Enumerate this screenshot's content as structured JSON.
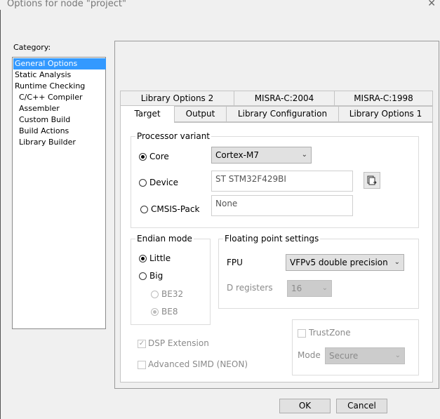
{
  "window": {
    "title": "Options for node \"project\"",
    "close_glyph": "✕"
  },
  "category": {
    "label": "Category:",
    "items": [
      {
        "label": "General Options",
        "selected": true
      },
      {
        "label": "Static Analysis"
      },
      {
        "label": "Runtime Checking"
      },
      {
        "label": "C/C++ Compiler"
      },
      {
        "label": "Assembler"
      },
      {
        "label": "Custom Build"
      },
      {
        "label": "Build Actions"
      },
      {
        "label": "Library Builder"
      }
    ]
  },
  "tabs": {
    "back_row": [
      "Library Options 2",
      "MISRA-C:2004",
      "MISRA-C:1998"
    ],
    "front_row": [
      "Target",
      "Output",
      "Library Configuration",
      "Library Options 1"
    ],
    "active": "Target"
  },
  "processor": {
    "legend": "Processor variant",
    "core_label": "Core",
    "core_value": "Cortex-M7",
    "device_label": "Device",
    "device_value": "ST STM32F429BI",
    "cmsis_label": "CMSIS-Pack",
    "cmsis_value": "None",
    "selected": "Core",
    "device_button_icon": "select-device-icon"
  },
  "endian": {
    "legend": "Endian mode",
    "little": "Little",
    "big": "Big",
    "be32": "BE32",
    "be8": "BE8",
    "selected": "Little"
  },
  "fpu": {
    "legend": "Floating point settings",
    "fpu_label": "FPU",
    "fpu_value": "VFPv5 double precision",
    "dreg_label": "D registers",
    "dreg_value": "16"
  },
  "options": {
    "dsp": "DSP Extension",
    "dsp_checked": true,
    "simd": "Advanced SIMD (NEON)",
    "simd_checked": false,
    "trustzone": "TrustZone",
    "trustzone_checked": false,
    "mode_label": "Mode",
    "mode_value": "Secure"
  },
  "buttons": {
    "ok": "OK",
    "cancel": "Cancel"
  }
}
